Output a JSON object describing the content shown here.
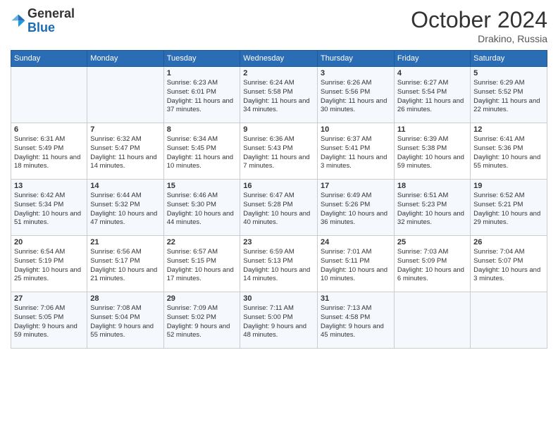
{
  "logo": {
    "general": "General",
    "blue": "Blue"
  },
  "header": {
    "month": "October 2024",
    "location": "Drakino, Russia"
  },
  "weekdays": [
    "Sunday",
    "Monday",
    "Tuesday",
    "Wednesday",
    "Thursday",
    "Friday",
    "Saturday"
  ],
  "weeks": [
    [
      {
        "day": "",
        "sunrise": "",
        "sunset": "",
        "daylight": ""
      },
      {
        "day": "",
        "sunrise": "",
        "sunset": "",
        "daylight": ""
      },
      {
        "day": "1",
        "sunrise": "Sunrise: 6:23 AM",
        "sunset": "Sunset: 6:01 PM",
        "daylight": "Daylight: 11 hours and 37 minutes."
      },
      {
        "day": "2",
        "sunrise": "Sunrise: 6:24 AM",
        "sunset": "Sunset: 5:58 PM",
        "daylight": "Daylight: 11 hours and 34 minutes."
      },
      {
        "day": "3",
        "sunrise": "Sunrise: 6:26 AM",
        "sunset": "Sunset: 5:56 PM",
        "daylight": "Daylight: 11 hours and 30 minutes."
      },
      {
        "day": "4",
        "sunrise": "Sunrise: 6:27 AM",
        "sunset": "Sunset: 5:54 PM",
        "daylight": "Daylight: 11 hours and 26 minutes."
      },
      {
        "day": "5",
        "sunrise": "Sunrise: 6:29 AM",
        "sunset": "Sunset: 5:52 PM",
        "daylight": "Daylight: 11 hours and 22 minutes."
      }
    ],
    [
      {
        "day": "6",
        "sunrise": "Sunrise: 6:31 AM",
        "sunset": "Sunset: 5:49 PM",
        "daylight": "Daylight: 11 hours and 18 minutes."
      },
      {
        "day": "7",
        "sunrise": "Sunrise: 6:32 AM",
        "sunset": "Sunset: 5:47 PM",
        "daylight": "Daylight: 11 hours and 14 minutes."
      },
      {
        "day": "8",
        "sunrise": "Sunrise: 6:34 AM",
        "sunset": "Sunset: 5:45 PM",
        "daylight": "Daylight: 11 hours and 10 minutes."
      },
      {
        "day": "9",
        "sunrise": "Sunrise: 6:36 AM",
        "sunset": "Sunset: 5:43 PM",
        "daylight": "Daylight: 11 hours and 7 minutes."
      },
      {
        "day": "10",
        "sunrise": "Sunrise: 6:37 AM",
        "sunset": "Sunset: 5:41 PM",
        "daylight": "Daylight: 11 hours and 3 minutes."
      },
      {
        "day": "11",
        "sunrise": "Sunrise: 6:39 AM",
        "sunset": "Sunset: 5:38 PM",
        "daylight": "Daylight: 10 hours and 59 minutes."
      },
      {
        "day": "12",
        "sunrise": "Sunrise: 6:41 AM",
        "sunset": "Sunset: 5:36 PM",
        "daylight": "Daylight: 10 hours and 55 minutes."
      }
    ],
    [
      {
        "day": "13",
        "sunrise": "Sunrise: 6:42 AM",
        "sunset": "Sunset: 5:34 PM",
        "daylight": "Daylight: 10 hours and 51 minutes."
      },
      {
        "day": "14",
        "sunrise": "Sunrise: 6:44 AM",
        "sunset": "Sunset: 5:32 PM",
        "daylight": "Daylight: 10 hours and 47 minutes."
      },
      {
        "day": "15",
        "sunrise": "Sunrise: 6:46 AM",
        "sunset": "Sunset: 5:30 PM",
        "daylight": "Daylight: 10 hours and 44 minutes."
      },
      {
        "day": "16",
        "sunrise": "Sunrise: 6:47 AM",
        "sunset": "Sunset: 5:28 PM",
        "daylight": "Daylight: 10 hours and 40 minutes."
      },
      {
        "day": "17",
        "sunrise": "Sunrise: 6:49 AM",
        "sunset": "Sunset: 5:26 PM",
        "daylight": "Daylight: 10 hours and 36 minutes."
      },
      {
        "day": "18",
        "sunrise": "Sunrise: 6:51 AM",
        "sunset": "Sunset: 5:23 PM",
        "daylight": "Daylight: 10 hours and 32 minutes."
      },
      {
        "day": "19",
        "sunrise": "Sunrise: 6:52 AM",
        "sunset": "Sunset: 5:21 PM",
        "daylight": "Daylight: 10 hours and 29 minutes."
      }
    ],
    [
      {
        "day": "20",
        "sunrise": "Sunrise: 6:54 AM",
        "sunset": "Sunset: 5:19 PM",
        "daylight": "Daylight: 10 hours and 25 minutes."
      },
      {
        "day": "21",
        "sunrise": "Sunrise: 6:56 AM",
        "sunset": "Sunset: 5:17 PM",
        "daylight": "Daylight: 10 hours and 21 minutes."
      },
      {
        "day": "22",
        "sunrise": "Sunrise: 6:57 AM",
        "sunset": "Sunset: 5:15 PM",
        "daylight": "Daylight: 10 hours and 17 minutes."
      },
      {
        "day": "23",
        "sunrise": "Sunrise: 6:59 AM",
        "sunset": "Sunset: 5:13 PM",
        "daylight": "Daylight: 10 hours and 14 minutes."
      },
      {
        "day": "24",
        "sunrise": "Sunrise: 7:01 AM",
        "sunset": "Sunset: 5:11 PM",
        "daylight": "Daylight: 10 hours and 10 minutes."
      },
      {
        "day": "25",
        "sunrise": "Sunrise: 7:03 AM",
        "sunset": "Sunset: 5:09 PM",
        "daylight": "Daylight: 10 hours and 6 minutes."
      },
      {
        "day": "26",
        "sunrise": "Sunrise: 7:04 AM",
        "sunset": "Sunset: 5:07 PM",
        "daylight": "Daylight: 10 hours and 3 minutes."
      }
    ],
    [
      {
        "day": "27",
        "sunrise": "Sunrise: 7:06 AM",
        "sunset": "Sunset: 5:05 PM",
        "daylight": "Daylight: 9 hours and 59 minutes."
      },
      {
        "day": "28",
        "sunrise": "Sunrise: 7:08 AM",
        "sunset": "Sunset: 5:04 PM",
        "daylight": "Daylight: 9 hours and 55 minutes."
      },
      {
        "day": "29",
        "sunrise": "Sunrise: 7:09 AM",
        "sunset": "Sunset: 5:02 PM",
        "daylight": "Daylight: 9 hours and 52 minutes."
      },
      {
        "day": "30",
        "sunrise": "Sunrise: 7:11 AM",
        "sunset": "Sunset: 5:00 PM",
        "daylight": "Daylight: 9 hours and 48 minutes."
      },
      {
        "day": "31",
        "sunrise": "Sunrise: 7:13 AM",
        "sunset": "Sunset: 4:58 PM",
        "daylight": "Daylight: 9 hours and 45 minutes."
      },
      {
        "day": "",
        "sunrise": "",
        "sunset": "",
        "daylight": ""
      },
      {
        "day": "",
        "sunrise": "",
        "sunset": "",
        "daylight": ""
      }
    ]
  ]
}
